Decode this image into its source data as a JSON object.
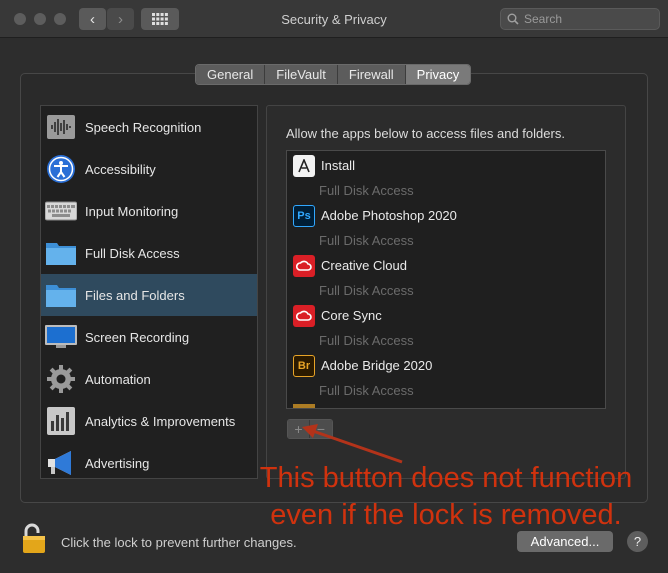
{
  "window": {
    "title": "Security & Privacy"
  },
  "toolbar": {
    "back": "‹",
    "forward": "›",
    "search_placeholder": "Search"
  },
  "tabs": [
    {
      "label": "General"
    },
    {
      "label": "FileVault"
    },
    {
      "label": "Firewall"
    },
    {
      "label": "Privacy",
      "selected": true
    }
  ],
  "sidebar": {
    "items": [
      {
        "label": "Speech Recognition",
        "icon": "speech-recognition-icon"
      },
      {
        "label": "Accessibility",
        "icon": "accessibility-icon"
      },
      {
        "label": "Input Monitoring",
        "icon": "keyboard-icon"
      },
      {
        "label": "Full Disk Access",
        "icon": "folder-icon"
      },
      {
        "label": "Files and Folders",
        "icon": "folder-icon",
        "selected": true
      },
      {
        "label": "Screen Recording",
        "icon": "display-icon"
      },
      {
        "label": "Automation",
        "icon": "gear-icon"
      },
      {
        "label": "Analytics & Improvements",
        "icon": "bar-chart-icon"
      },
      {
        "label": "Advertising",
        "icon": "megaphone-icon"
      }
    ]
  },
  "main": {
    "caption": "Allow the apps below to access files and folders.",
    "apps": [
      {
        "name": "Install",
        "permission": "Full Disk Access",
        "icon": "adobe-installer-icon"
      },
      {
        "name": "Adobe Photoshop 2020",
        "permission": "Full Disk Access",
        "icon": "photoshop-icon",
        "icon_text": "Ps"
      },
      {
        "name": "Creative Cloud",
        "permission": "Full Disk Access",
        "icon": "creative-cloud-icon"
      },
      {
        "name": "Core Sync",
        "permission": "Full Disk Access",
        "icon": "creative-cloud-icon"
      },
      {
        "name": "Adobe Bridge 2020",
        "permission": "Full Disk Access",
        "icon": "bridge-icon",
        "icon_text": "Br"
      }
    ],
    "stepper": {
      "plus": "+",
      "minus": "−"
    }
  },
  "annotation": {
    "line1": "This button does not function",
    "line2": "even if the lock is removed."
  },
  "footer": {
    "lock_text": "Click the lock to prevent further changes.",
    "advanced_label": "Advanced...",
    "help_label": "?"
  },
  "colors": {
    "selection": "#2f4a5e",
    "annotation": "#d0320e",
    "photoshop": "#31a8ff",
    "bridge": "#e8a427",
    "creative_cloud": "#da1f26"
  }
}
